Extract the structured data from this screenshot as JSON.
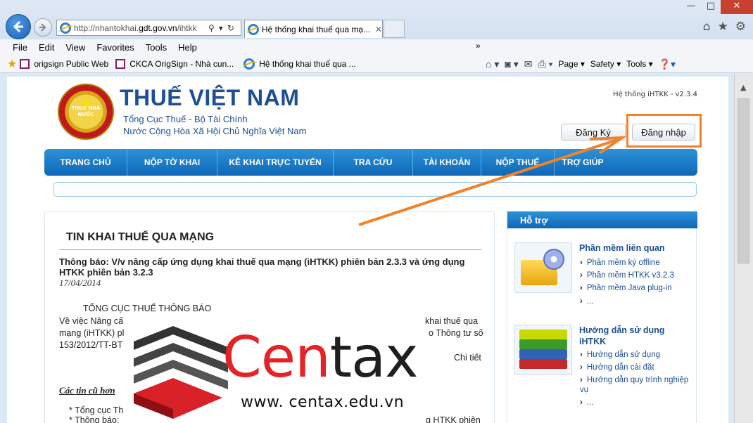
{
  "browser": {
    "address_prefix": "http://nhantokhai.",
    "address_domain": "gdt.gov.vn",
    "address_suffix": "/ihtkk",
    "tab_title": "Hệ thống khai thuế qua mạ...",
    "window_controls": [
      "—",
      "□",
      "✕"
    ]
  },
  "menubar": [
    "File",
    "Edit",
    "View",
    "Favorites",
    "Tools",
    "Help"
  ],
  "favorites": [
    {
      "label": "origsign Public Web"
    },
    {
      "label": "CKCA OrigSign - Nhà cun..."
    },
    {
      "label": "Hệ thống khai thuế qua ..."
    }
  ],
  "commandbar": {
    "more": "»",
    "page": "Page ▾",
    "safety": "Safety ▾",
    "tools": "Tools ▾"
  },
  "site": {
    "emblem_text": "THUẾ NHÀ NƯỚC",
    "brand_title": "THUẾ VIỆT NAM",
    "brand_line1": "Tổng Cục Thuế - Bộ Tài Chính",
    "brand_line2": "Nước Cộng Hòa Xã Hội Chủ Nghĩa Việt Nam",
    "version": "Hệ thống iHTKK - v2.3.4",
    "register": "Đăng Ký",
    "login": "Đăng nhập"
  },
  "nav": [
    "TRANG CHỦ",
    "NỘP TỜ KHAI",
    "KÊ KHAI TRỰC TUYẾN",
    "TRA CỨU",
    "TÀI KHOẢN",
    "NỘP THUẾ",
    "TRỢ GIÚP"
  ],
  "main": {
    "title": "TIN KHAI THUẾ QUA MẠNG",
    "notice_title": "Thông báo: V/v nâng cấp ứng dụng khai thuế qua mạng (iHTKK) phiên bản 2.3.3 và ứng dụng HTKK phiên bản 3.2.3",
    "notice_date": "17/04/2014",
    "para_heading": "TỔNG CỤC THUẾ THÔNG BÁO",
    "para_line1_left": "Về việc Nâng cấ",
    "para_line1_right": "khai thuế qua",
    "para_line2_left": "mạng (iHTKK) pl",
    "para_line2_right": "o Thông tư số",
    "para_line3_left": "153/2012/TT-BT",
    "more": "Chi tiết",
    "old_news_title": "Các tin cũ hơn",
    "old_item1": "* Tổng cục Th",
    "old_item2": "* Thông báo:",
    "old_item2_right": "g HTKK phiên"
  },
  "support": {
    "title": "Hỗ trợ",
    "sec1_title": "Phần mềm liên quan",
    "sec1_links": [
      "Phần mềm ký offline",
      "Phần mềm HTKK v3.2.3",
      "Phần mềm Java plug-in",
      "..."
    ],
    "sec2_title": "Hướng dẫn sử dụng iHTKK",
    "sec2_links": [
      "Hướng dẫn sử dụng",
      "Hướng dẫn cài đặt",
      "Hướng dẫn quy trình nghiệp vụ",
      "..."
    ]
  },
  "logo": {
    "text_red": "Cen",
    "text_dark": "tax",
    "url": "www. centax.edu.vn"
  },
  "colors": {
    "nav_blue": "#0e67b7",
    "highlight_orange": "#f0832a",
    "logo_red": "#e32326",
    "brand_blue": "#1c4f93"
  }
}
